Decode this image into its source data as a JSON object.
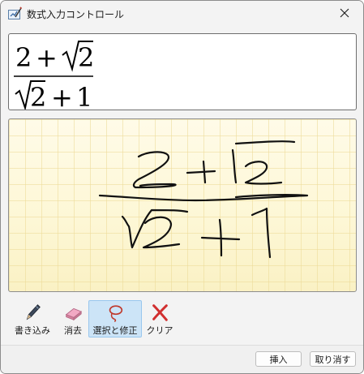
{
  "window": {
    "title": "数式入力コントロール"
  },
  "preview": {
    "numerator": {
      "left": "2",
      "op": "+",
      "radicand": "2"
    },
    "denominator": {
      "radicand": "2",
      "op": "+",
      "right": "1"
    }
  },
  "toolbar": {
    "tools": [
      {
        "label": "書き込み",
        "icon": "pen-icon",
        "selected": false
      },
      {
        "label": "消去",
        "icon": "eraser-icon",
        "selected": false
      },
      {
        "label": "選択と修正",
        "icon": "lasso-icon",
        "selected": true
      },
      {
        "label": "クリア",
        "icon": "clear-icon",
        "selected": false
      }
    ]
  },
  "footer": {
    "insert_label": "挿入",
    "cancel_label": "取り消す"
  },
  "colors": {
    "ink": "#111111",
    "pad_background": "#fdf7d6",
    "selected_tool": "#cce4f7"
  }
}
